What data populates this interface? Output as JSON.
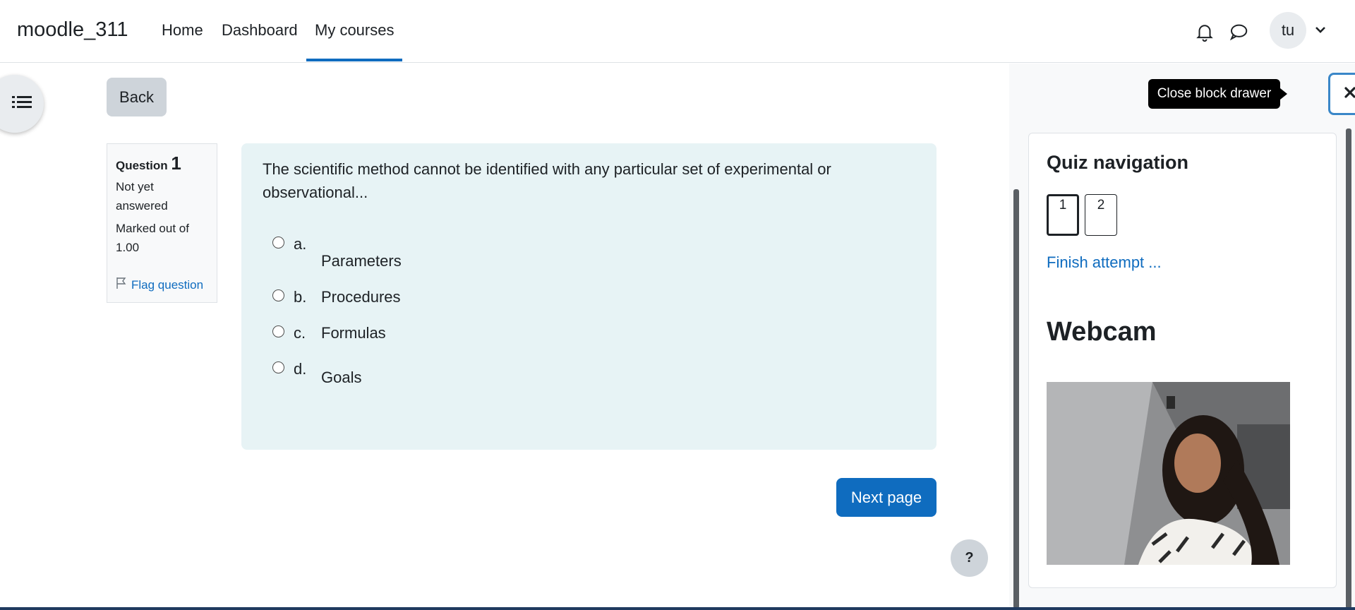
{
  "navbar": {
    "brand": "moodle_311",
    "links": [
      {
        "label": "Home"
      },
      {
        "label": "Dashboard"
      },
      {
        "label": "My courses",
        "active": true
      }
    ],
    "icons": [
      "bell-icon",
      "chat-icon"
    ],
    "user_initials": "tu"
  },
  "back_label": "Back",
  "question_info": {
    "question_word": "Question",
    "number": "1",
    "status_line1": "Not yet",
    "status_line2": "answered",
    "marked_line1": "Marked out of",
    "marked_line2": "1.00",
    "flag_label": "Flag question"
  },
  "question": {
    "text": "The scientific method cannot be identified with any particular set of experimental or observational...",
    "options": [
      {
        "letter": "a.",
        "text": "Parameters"
      },
      {
        "letter": "b.",
        "text": "Procedures"
      },
      {
        "letter": "c.",
        "text": "Formulas"
      },
      {
        "letter": "d.",
        "text": "Goals"
      }
    ]
  },
  "next_label": "Next page",
  "help_label": "?",
  "drawer": {
    "tooltip": "Close block drawer",
    "quiz_nav_title": "Quiz navigation",
    "nav_buttons": [
      "1",
      "2"
    ],
    "finish_label": "Finish attempt ...",
    "webcam_title": "Webcam"
  },
  "colors": {
    "primary": "#0f6cbf",
    "question_bg": "#e7f3f5",
    "drawer_bg": "#f8f9fa"
  }
}
